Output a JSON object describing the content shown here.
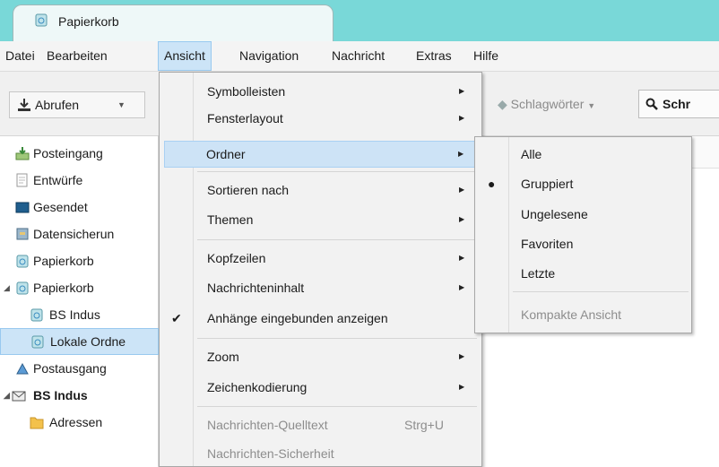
{
  "tab": {
    "title": "Papierkorb",
    "icon": "trash-icon"
  },
  "menubar": {
    "items": [
      {
        "label": "Datei"
      },
      {
        "label": "Bearbeiten"
      },
      {
        "label": "Ansicht"
      },
      {
        "label": "Navigation"
      },
      {
        "label": "Nachricht"
      },
      {
        "label": "Extras"
      },
      {
        "label": "Hilfe"
      }
    ],
    "active": "Ansicht"
  },
  "toolbar": {
    "get_mail_label": "Abrufen",
    "tags_label": "Schlagwörter",
    "search_label": "Schr"
  },
  "folders": [
    {
      "label": "Posteingang",
      "icon": "inbox-icon"
    },
    {
      "label": "Entwürfe",
      "icon": "drafts-icon"
    },
    {
      "label": "Gesendet",
      "icon": "sent-icon"
    },
    {
      "label": "Datensicherun",
      "icon": "archive-icon"
    },
    {
      "label": "Papierkorb",
      "icon": "trash-icon"
    },
    {
      "label": "Papierkorb",
      "icon": "trash-icon"
    },
    {
      "label": "BS Indus",
      "icon": "trash-icon"
    },
    {
      "label": "Lokale Ordne",
      "icon": "trash-icon"
    },
    {
      "label": "Postausgang",
      "icon": "outbox-icon"
    },
    {
      "label": "BS Indus",
      "icon": "account-icon"
    },
    {
      "label": "Adressen",
      "icon": "folder-icon"
    }
  ],
  "view_menu": {
    "items": [
      {
        "label": "Symbolleisten",
        "submenu": true
      },
      {
        "label": "Fensterlayout",
        "submenu": true
      },
      {
        "label": "Ordner",
        "submenu": true
      },
      {
        "label": "Sortieren nach",
        "submenu": true
      },
      {
        "label": "Themen",
        "submenu": true
      },
      {
        "label": "Kopfzeilen",
        "submenu": true
      },
      {
        "label": "Nachrichteninhalt",
        "submenu": true
      },
      {
        "label": "Anhänge eingebunden anzeigen",
        "checked": true
      },
      {
        "label": "Zoom",
        "submenu": true
      },
      {
        "label": "Zeichenkodierung",
        "submenu": true
      },
      {
        "label": "Nachrichten-Quelltext",
        "shortcut": "Strg+U",
        "disabled": true
      },
      {
        "label": "Nachrichten-Sicherheit",
        "disabled": true
      }
    ]
  },
  "folder_submenu": {
    "items": [
      {
        "label": "Alle"
      },
      {
        "label": "Gruppiert",
        "selected": true
      },
      {
        "label": "Ungelesene"
      },
      {
        "label": "Favoriten"
      },
      {
        "label": "Letzte"
      },
      {
        "label": "Kompakte Ansicht",
        "disabled": true
      }
    ]
  },
  "colors": {
    "titlebar": "#79d8d8",
    "highlight": "#cde3f6",
    "selected_folder": "#cce4f7"
  }
}
